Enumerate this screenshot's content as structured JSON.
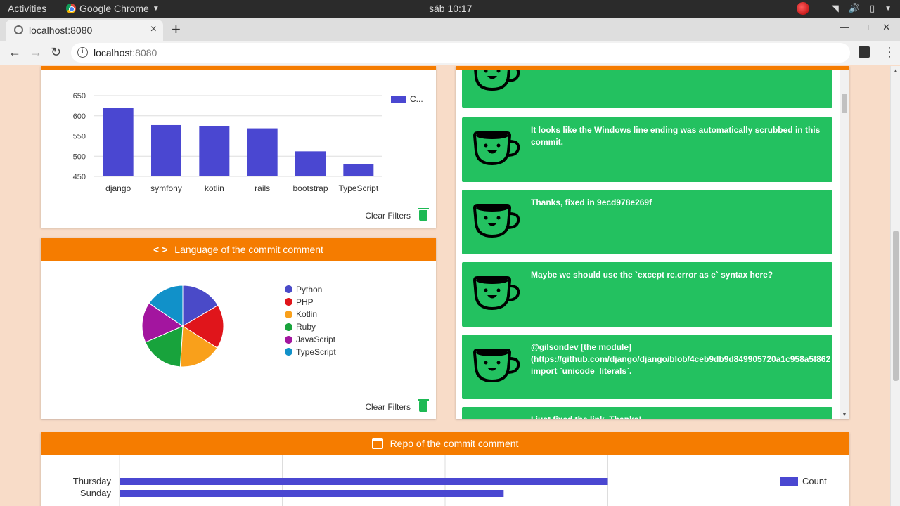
{
  "os": {
    "activities": "Activities",
    "app_name": "Google Chrome",
    "clock": "sáb 10:17"
  },
  "browser": {
    "tab_title": "localhost:8080",
    "url_host": "localhost",
    "url_port": ":8080"
  },
  "bar_card": {
    "clear_label": "Clear Filters",
    "legend_label": "C...",
    "bar_color": "#4a47d1",
    "chart_data": {
      "type": "bar",
      "categories": [
        "django",
        "symfony",
        "kotlin",
        "rails",
        "bootstrap",
        "TypeScript"
      ],
      "values": [
        620,
        577,
        574,
        569,
        512,
        481
      ],
      "ylim": [
        450,
        650
      ],
      "yticks": [
        "650",
        "600",
        "550",
        "500",
        "450"
      ],
      "ytick_values": [
        650,
        600,
        550,
        500,
        450
      ]
    }
  },
  "pie_card": {
    "title": "Language of the commit comment",
    "clear_label": "Clear Filters",
    "chart_data": {
      "type": "pie",
      "labels": [
        "Python",
        "PHP",
        "Kotlin",
        "Ruby",
        "JavaScript",
        "TypeScript"
      ],
      "values": [
        16.5,
        17.5,
        17,
        17.5,
        16,
        15.5
      ],
      "colors": [
        "#4a4ac8",
        "#e0151b",
        "#f9a01b",
        "#18a33c",
        "#a3159f",
        "#1191c9"
      ]
    }
  },
  "comments": [
    {
      "text": ""
    },
    {
      "text": "It looks like the Windows line ending was automatically scrubbed in this\ncommit."
    },
    {
      "text": "Thanks, fixed in 9ecd978e269f"
    },
    {
      "text": "Maybe we should use the `except re.error as e` syntax here?"
    },
    {
      "text": "@gilsondev [the module]\n(https://github.com/django/django/blob/4ceb9db9d849905720a1c958a5f862\nimport `unicode_literals`."
    },
    {
      "text": "I just fixed the link. Thanks!"
    }
  ],
  "repo_card": {
    "title": "Repo of the commit comment",
    "legend_label": "Count",
    "chart_data": {
      "type": "bar",
      "orientation": "horizontal",
      "categories": [
        "Thursday",
        "Sunday"
      ],
      "values": [
        75,
        59
      ]
    }
  }
}
